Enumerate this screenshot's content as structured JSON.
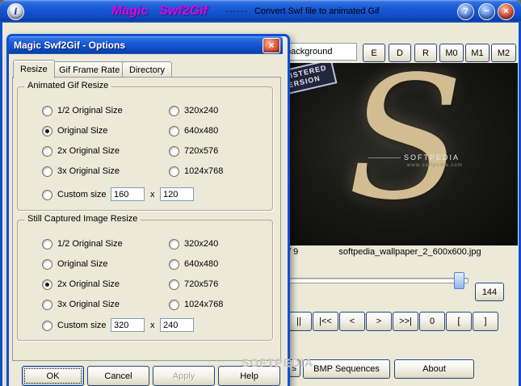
{
  "titlebar": {
    "info_glyph": "i",
    "title_word1": "Magic",
    "title_word2": "Swf2Gif",
    "dashes": "------",
    "subtitle": "Convert Swf file to animated Gif",
    "help_glyph": "?",
    "minimize_glyph": "−",
    "close_glyph": "×"
  },
  "toolbar": {
    "background_field_value": "background",
    "buttons": [
      "E",
      "D",
      "R",
      "M0",
      "M1",
      "M2"
    ]
  },
  "preview": {
    "stamp_line1": "REGISTERED",
    "stamp_line2": "VERSION",
    "big_letter": "S",
    "brand": "SOFTPEDIA",
    "brand_url": "www.softpedia.com",
    "frame_counter": "/ 9",
    "filename": "softpedia_wallpaper_2_600x600.jpg"
  },
  "transport": {
    "frame_value": "144",
    "buttons": [
      "||",
      "|<<",
      "<",
      ">",
      ">>|",
      "0",
      "[",
      "]"
    ]
  },
  "bottombar": {
    "partial_button_label": "s",
    "bmp_sequences_label": "BMP Sequences",
    "about_label": "About"
  },
  "watermark": "SOFTPEDIA",
  "dialog": {
    "title": "Magic Swf2Gif - Options",
    "close_glyph": "×",
    "tabs": [
      "Resize",
      "Gif Frame Rate",
      "Directory"
    ],
    "group1": {
      "title": "Animated Gif Resize",
      "options_left": [
        {
          "label": "1/2 Original Size",
          "checked": false
        },
        {
          "label": "Original Size",
          "checked": true
        },
        {
          "label": "2x Original Size",
          "checked": false
        },
        {
          "label": "3x Original Size",
          "checked": false
        }
      ],
      "options_right": [
        {
          "label": "320x240",
          "checked": false
        },
        {
          "label": "640x480",
          "checked": false
        },
        {
          "label": "720x576",
          "checked": false
        },
        {
          "label": "1024x768",
          "checked": false
        }
      ],
      "custom": {
        "label": "Custom size",
        "checked": false,
        "width_value": "160",
        "separator": "x",
        "height_value": "120"
      }
    },
    "group2": {
      "title": "Still Captured Image Resize",
      "options_left": [
        {
          "label": "1/2 Original Size",
          "checked": false
        },
        {
          "label": "Original Size",
          "checked": false
        },
        {
          "label": "2x Original Size",
          "checked": true
        },
        {
          "label": "3x Original Size",
          "checked": false
        }
      ],
      "options_right": [
        {
          "label": "320x240",
          "checked": false
        },
        {
          "label": "640x480",
          "checked": false
        },
        {
          "label": "720x576",
          "checked": false
        },
        {
          "label": "1024x768",
          "checked": false
        }
      ],
      "custom": {
        "label": "Custom size",
        "checked": false,
        "width_value": "320",
        "separator": "x",
        "height_value": "240"
      }
    },
    "buttons": {
      "ok": "OK",
      "cancel": "Cancel",
      "apply": "Apply",
      "help": "Help"
    }
  }
}
